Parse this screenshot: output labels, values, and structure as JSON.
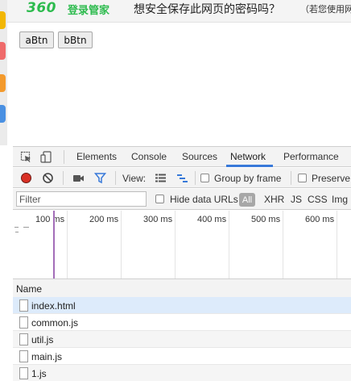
{
  "password_bar": {
    "brand": "360",
    "brand_name": "登录管家",
    "question": "想安全保存此网页的密码吗？",
    "hint": "（若您使用网"
  },
  "page": {
    "buttons": [
      "aBtn",
      "bBtn"
    ]
  },
  "devtools": {
    "tabs": [
      "Elements",
      "Console",
      "Sources",
      "Network",
      "Performance"
    ],
    "active_tab": "Network",
    "toolbar": {
      "view_label": "View:",
      "group_by_frame": "Group by frame",
      "preserve_log": "Preserve l"
    },
    "filter": {
      "placeholder": "Filter",
      "hide_data_urls": "Hide data URLs",
      "types": [
        "All",
        "XHR",
        "JS",
        "CSS",
        "Img"
      ],
      "active_type": "All"
    },
    "timeline": {
      "ticks": [
        "100 ms",
        "200 ms",
        "300 ms",
        "400 ms",
        "500 ms",
        "600 ms"
      ]
    },
    "table": {
      "name_header": "Name",
      "rows": [
        "index.html",
        "common.js",
        "util.js",
        "main.js",
        "1.js"
      ]
    }
  },
  "colors": {
    "brand_green": "#2dbb4e",
    "accent_blue": "#3879d9",
    "record_red": "#d93025",
    "selected_row": "#ddebfb"
  }
}
